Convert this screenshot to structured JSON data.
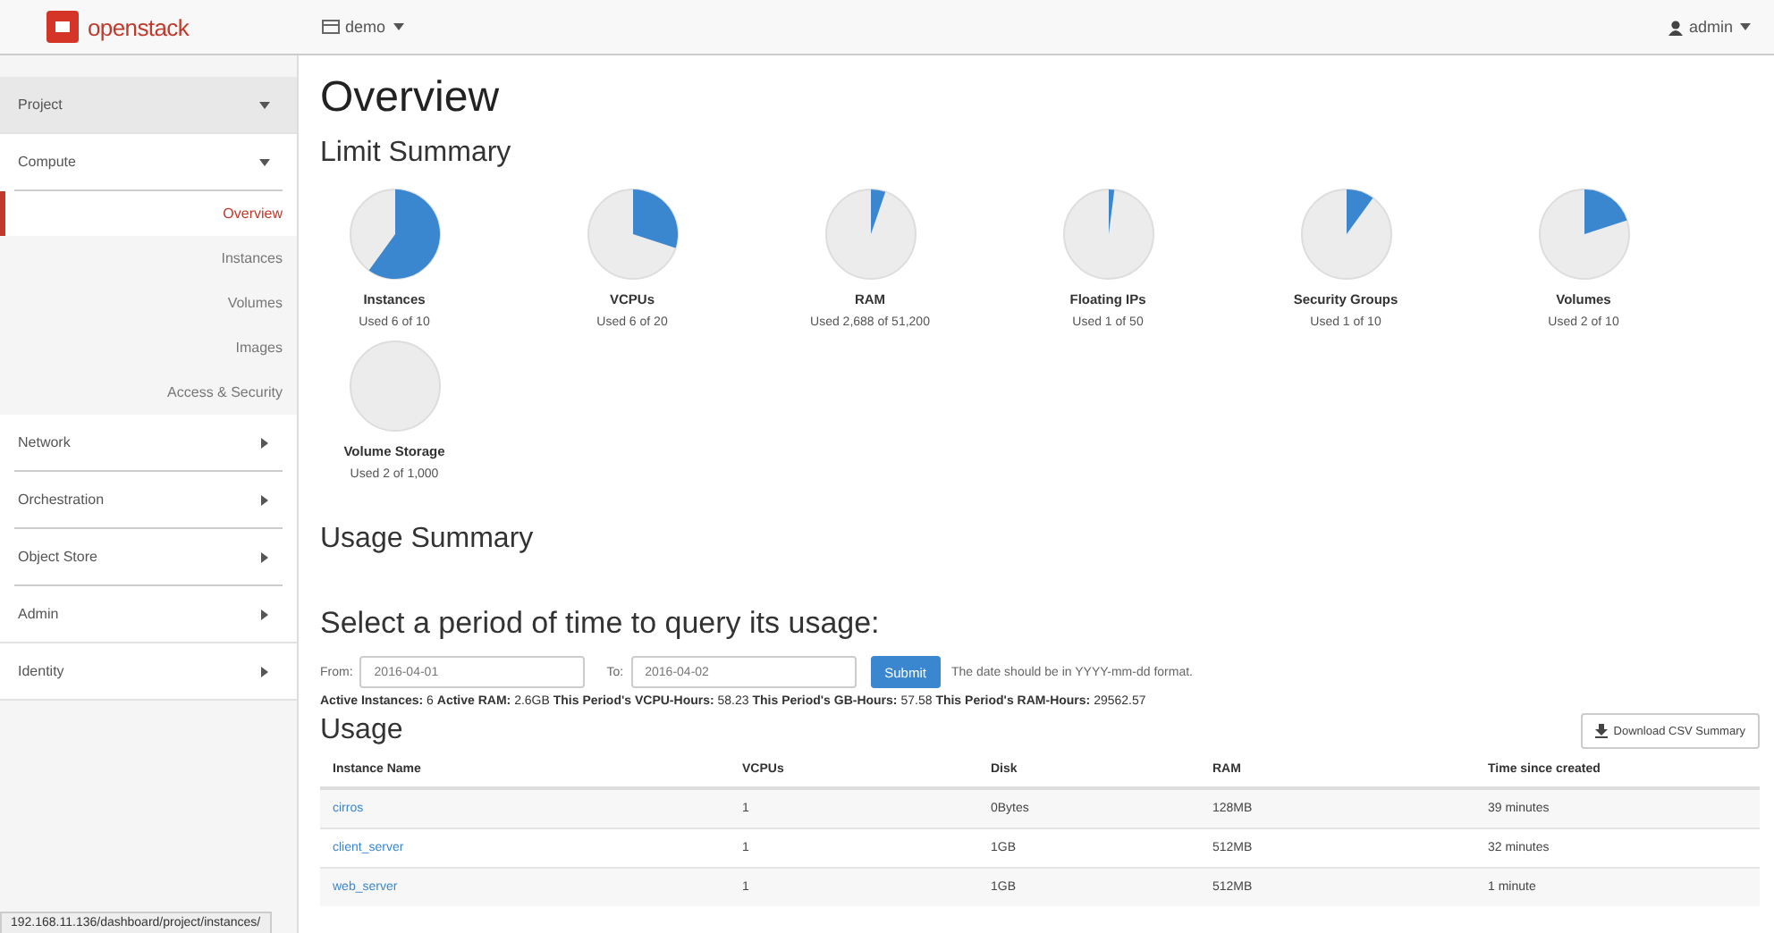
{
  "topbar": {
    "logo": "openstack",
    "project": "demo",
    "user": "admin"
  },
  "sidebar": {
    "items": [
      {
        "label": "Project",
        "expanded": true,
        "children": [
          {
            "label": "Compute",
            "expanded": true,
            "children": [
              {
                "label": "Overview",
                "selected": true
              },
              {
                "label": "Instances",
                "selected": false
              },
              {
                "label": "Volumes",
                "selected": false
              },
              {
                "label": "Images",
                "selected": false
              },
              {
                "label": "Access & Security",
                "selected": false
              }
            ]
          },
          {
            "label": "Network",
            "expanded": false
          },
          {
            "label": "Orchestration",
            "expanded": false
          },
          {
            "label": "Object Store",
            "expanded": false
          }
        ]
      },
      {
        "label": "Admin",
        "expanded": false
      },
      {
        "label": "Identity",
        "expanded": false
      }
    ]
  },
  "page": {
    "title": "Overview",
    "limit_summary": {
      "heading": "Limit Summary",
      "limits": [
        {
          "name": "Instances",
          "usage": "Used 6 of 10"
        },
        {
          "name": "VCPUs",
          "usage": "Used 6 of 20"
        },
        {
          "name": "RAM",
          "usage": "Used 2,688 of 51,200"
        },
        {
          "name": "Floating IPs",
          "usage": "Used 1 of 50"
        },
        {
          "name": "Security Groups",
          "usage": "Used 1 of 10"
        },
        {
          "name": "Volumes",
          "usage": "Used 2 of 10"
        },
        {
          "name": "Volume Storage",
          "usage": "Used 2 of 1,000"
        }
      ]
    },
    "usage_summary": {
      "heading": "Usage Summary",
      "query_heading": "Select a period of time to query its usage:",
      "from_label": "From:",
      "from_value": "2016-04-01",
      "to_label": "To:",
      "to_value": "2016-04-02",
      "submit": "Submit",
      "hint": "The date should be in YYYY-mm-dd format.",
      "stats": "**Active Instances:** 6 **Active RAM:** 2.6GB **This Period's VCPU-Hours:** 58.23 **This Period's GB-Hours:** 57.58 **This Period's RAM-Hours:** 29562.57"
    },
    "usage": {
      "heading": "Usage",
      "download": "Download CSV Summary",
      "columns": [
        "Instance Name",
        "VCPUs",
        "Disk",
        "RAM",
        "Time since created"
      ],
      "rows": [
        [
          "cirros",
          "1",
          "0Bytes",
          "128MB",
          "39 minutes"
        ],
        [
          "client_server",
          "1",
          "1GB",
          "512MB",
          "32 minutes"
        ],
        [
          "web_server",
          "1",
          "1GB",
          "512MB",
          "1 minute"
        ]
      ]
    }
  },
  "status_bar": "192.168.11.136/dashboard/project/instances/"
}
